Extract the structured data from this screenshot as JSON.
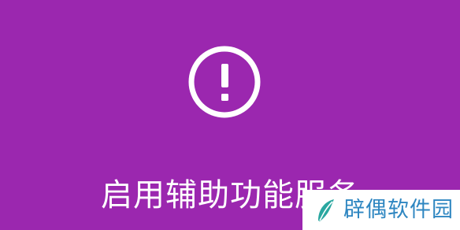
{
  "dialog": {
    "title": "启用辅助功能服务"
  },
  "watermark": {
    "text": "辟偶软件园",
    "icon": "leaf-logo-icon"
  },
  "colors": {
    "background": "#9b27af",
    "foreground": "#ffffff",
    "watermark_text": "#2e86c1",
    "watermark_logo": "#2aa7a0"
  },
  "icons": {
    "alert": "exclamation-circle-icon"
  }
}
